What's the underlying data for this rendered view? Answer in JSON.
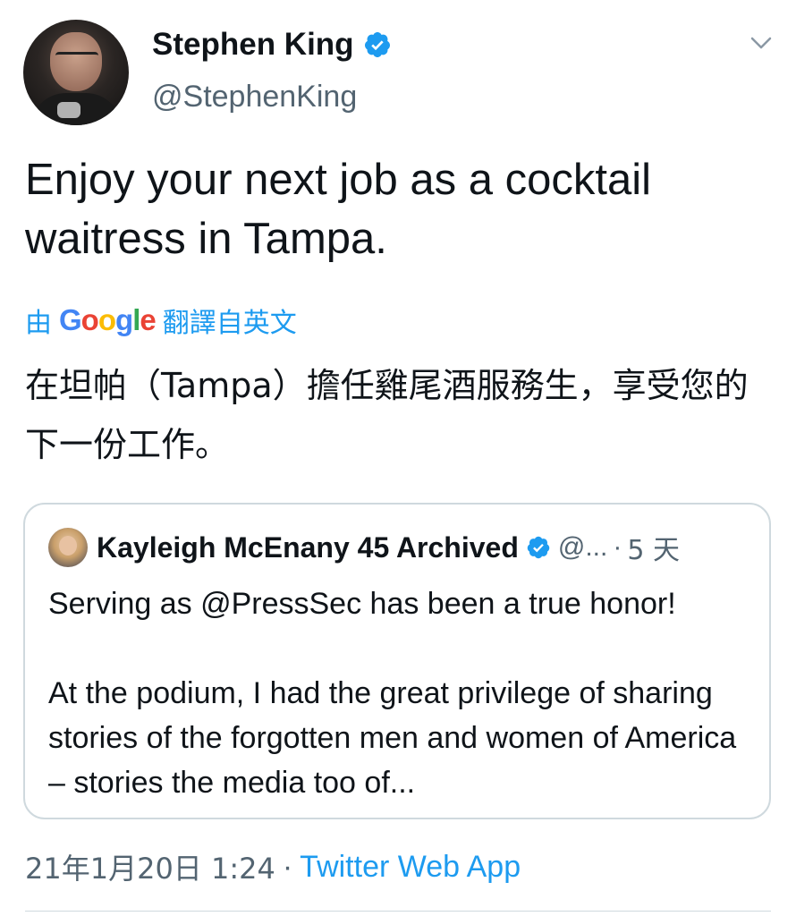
{
  "author": {
    "display_name": "Stephen King",
    "handle": "@StephenKing",
    "verified": true,
    "verified_icon": "verified-badge-icon",
    "avatar_icon": "profile-photo"
  },
  "tweet": {
    "text": "Enjoy your next job as a cocktail waitress in Tampa."
  },
  "translation": {
    "prefix": "由",
    "provider": "Google",
    "suffix": "翻譯自英文",
    "text": "在坦帕（Tampa）擔任雞尾酒服務生，享受您的下一份工作。"
  },
  "quoted_tweet": {
    "author_name": "Kayleigh McEnany 45 Archived",
    "handle": "@...",
    "separator": "·",
    "time": "5 天",
    "paragraph_1": "Serving as @PressSec has been a true honor!",
    "paragraph_2": "At the podium, I had the great privilege of sharing stories of the forgotten men and women of America – stories the media too of..."
  },
  "footer": {
    "date": "21年1月20日 1:24",
    "separator": "·",
    "source": "Twitter Web App"
  },
  "colors": {
    "link": "#1d9bf0",
    "secondary_text": "#536471",
    "border": "#cfd9de",
    "primary_text": "#0f1419"
  }
}
